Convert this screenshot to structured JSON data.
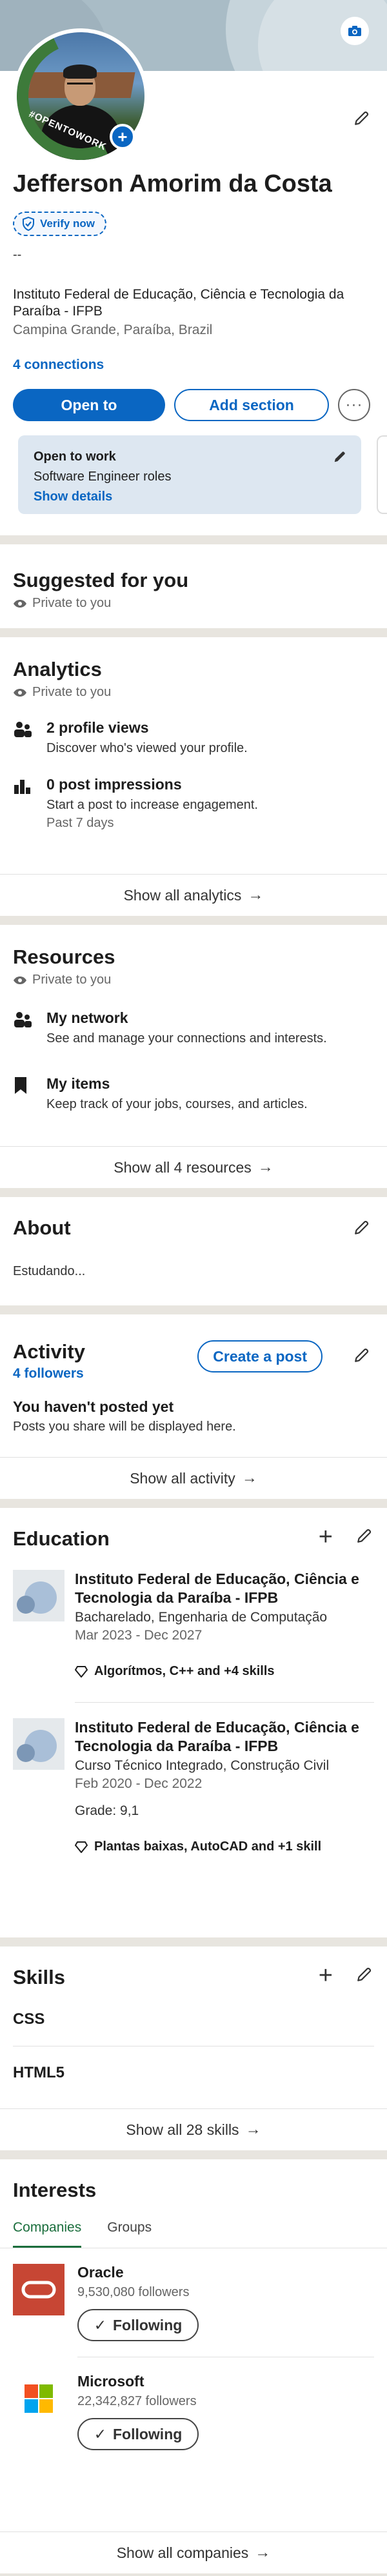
{
  "profile": {
    "name": "Jefferson Amorim da Costa",
    "verify_label": "Verify now",
    "headline": "--",
    "school": "Instituto Federal de Educação, Ciência e Tecnologia da Paraíba - IFPB",
    "location": "Campina Grande, Paraíba, Brazil",
    "connections": "4 connections",
    "open_to_label": "Open to",
    "add_section_label": "Add section",
    "more_label": "···",
    "avatar_frame_text": "#OPENTOWORK",
    "open_to_work": {
      "title": "Open to work",
      "roles": "Software Engineer roles",
      "link": "Show details"
    }
  },
  "suggested": {
    "title": "Suggested for you",
    "private": "Private to you"
  },
  "analytics": {
    "title": "Analytics",
    "private": "Private to you",
    "items": [
      {
        "title": "2 profile views",
        "desc": "Discover who's viewed your profile.",
        "sub": ""
      },
      {
        "title": "0 post impressions",
        "desc": "Start a post to increase engagement.",
        "sub": "Past 7 days"
      }
    ],
    "show_all": "Show all analytics"
  },
  "resources": {
    "title": "Resources",
    "private": "Private to you",
    "items": [
      {
        "title": "My network",
        "desc": "See and manage your connections and interests."
      },
      {
        "title": "My items",
        "desc": "Keep track of your jobs, courses, and articles."
      }
    ],
    "show_all": "Show all 4 resources"
  },
  "about": {
    "title": "About",
    "text": "Estudando..."
  },
  "activity": {
    "title": "Activity",
    "followers": "4 followers",
    "create_post": "Create a post",
    "empty_title": "You haven't posted yet",
    "empty_desc": "Posts you share will be displayed here.",
    "show_all": "Show all activity"
  },
  "education": {
    "title": "Education",
    "items": [
      {
        "name": "Instituto Federal de Educação, Ciência e Tecnologia da Paraíba - IFPB",
        "degree": "Bacharelado, Engenharia de Computação",
        "dates": "Mar 2023 - Dec 2027",
        "grade": "",
        "skills": "Algorítmos, C++ and +4 skills"
      },
      {
        "name": "Instituto Federal de Educação, Ciência e Tecnologia da Paraíba - IFPB",
        "degree": "Curso Técnico Integrado, Construção Civil",
        "dates": "Feb 2020 - Dec 2022",
        "grade": "Grade: 9,1",
        "skills": "Plantas baixas, AutoCAD and +1 skill"
      }
    ]
  },
  "skills": {
    "title": "Skills",
    "items": [
      "CSS",
      "HTML5"
    ],
    "show_all": "Show all 28 skills"
  },
  "interests": {
    "title": "Interests",
    "tabs": [
      "Companies",
      "Groups"
    ],
    "companies": [
      {
        "name": "Oracle",
        "followers": "9,530,080 followers",
        "button": "Following"
      },
      {
        "name": "Microsoft",
        "followers": "22,342,827 followers",
        "button": "Following"
      }
    ],
    "show_all": "Show all companies"
  },
  "colors": {
    "brand_blue": "#0a66c2",
    "open_to_work_green": "#3d7a3a",
    "oracle_red": "#c74634"
  }
}
